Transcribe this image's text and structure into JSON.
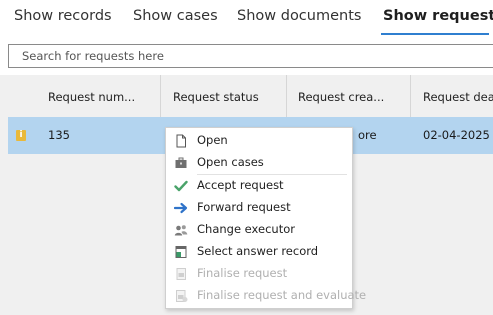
{
  "tabs": [
    {
      "label": "Show records",
      "active": false
    },
    {
      "label": "Show cases",
      "active": false
    },
    {
      "label": "Show documents",
      "active": false
    },
    {
      "label": "Show requests",
      "active": true
    }
  ],
  "search": {
    "placeholder": "Search for requests here",
    "value": ""
  },
  "table": {
    "columns": [
      "Request num...",
      "Request status",
      "Request crea...",
      "Request dea..."
    ],
    "rows": [
      {
        "icon": "info-icon",
        "number": "135",
        "status": "",
        "created": "ore",
        "deadline": "02-04-2025",
        "selected": true
      }
    ]
  },
  "context_menu": {
    "items": [
      {
        "label": "Open",
        "icon": "document-icon",
        "enabled": true
      },
      {
        "label": "Open cases",
        "icon": "briefcase-icon",
        "enabled": true
      },
      {
        "label": "Accept request",
        "icon": "checkmark-icon",
        "enabled": true
      },
      {
        "label": "Forward request",
        "icon": "arrow-right-icon",
        "enabled": true
      },
      {
        "label": "Change executor",
        "icon": "users-icon",
        "enabled": true
      },
      {
        "label": "Select answer record",
        "icon": "record-select-icon",
        "enabled": true
      },
      {
        "label": "Finalise request",
        "icon": "finalise-icon",
        "enabled": false
      },
      {
        "label": "Finalise request and evaluate",
        "icon": "finalise-evaluate-icon",
        "enabled": false
      }
    ]
  },
  "colors": {
    "accent": "#2f7fd0",
    "selected_row": "#b3d4ef",
    "check_green": "#4aa36a",
    "arrow_blue": "#2f73c9",
    "disabled_text": "#b0b0b0"
  }
}
